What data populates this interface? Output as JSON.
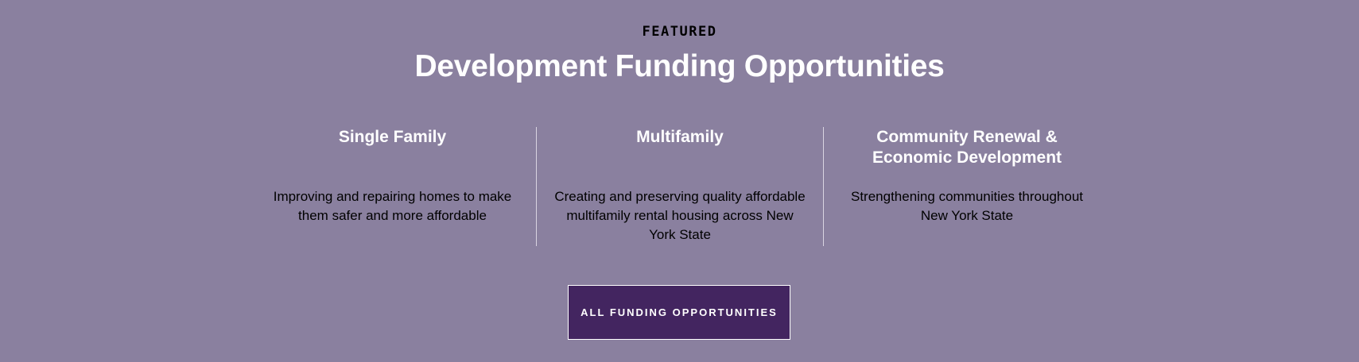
{
  "section": {
    "eyebrow": "FEATURED",
    "title": "Development Funding Opportunities"
  },
  "columns": [
    {
      "heading": "Single Family",
      "description": "Improving and repairing homes to make them safer and more affordable"
    },
    {
      "heading": "Multifamily",
      "description": "Creating and preserving quality affordable multifamily rental housing across New York State"
    },
    {
      "heading": "Community Renewal & Economic Development",
      "description": "Strengthening communities throughout New York State"
    }
  ],
  "cta": {
    "label": "ALL FUNDING OPPORTUNITIES"
  },
  "colors": {
    "background": "#8a809f",
    "button": "#432560",
    "heading": "#ffffff",
    "body_text": "#000000",
    "divider": "#d9d4e2"
  }
}
